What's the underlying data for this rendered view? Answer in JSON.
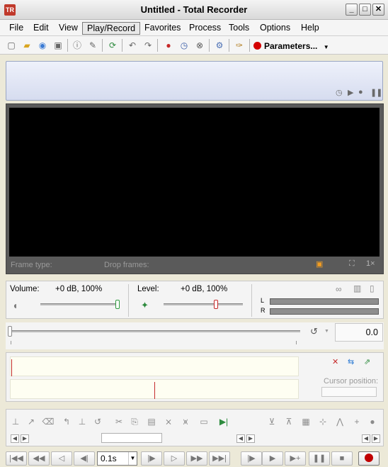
{
  "window": {
    "title": "Untitled - Total Recorder"
  },
  "menu": [
    {
      "label": "File"
    },
    {
      "label": "Edit"
    },
    {
      "label": "View"
    },
    {
      "label": "Play/Record"
    },
    {
      "label": "Favorites"
    },
    {
      "label": "Process"
    },
    {
      "label": "Tools"
    },
    {
      "label": "Options"
    },
    {
      "label": "Help"
    }
  ],
  "toolbar": {
    "parameters_label": "Parameters..."
  },
  "video": {
    "frame_type_label": "Frame type:",
    "drop_frames_label": "Drop frames:",
    "zoom_label": "1×"
  },
  "levels": {
    "volume_label": "Volume:",
    "volume_value": "+0 dB, 100%",
    "level_label": "Level:",
    "level_value": "+0 dB, 100%",
    "left_channel": "L",
    "right_channel": "R"
  },
  "position": {
    "value": "0.0"
  },
  "wave": {
    "cursor_position_label": "Cursor position:"
  },
  "transport": {
    "speed": "0.1s"
  },
  "colors": {
    "record_red": "#d40000",
    "video_bg": "#000000",
    "status_panel": "#dde2f2"
  }
}
